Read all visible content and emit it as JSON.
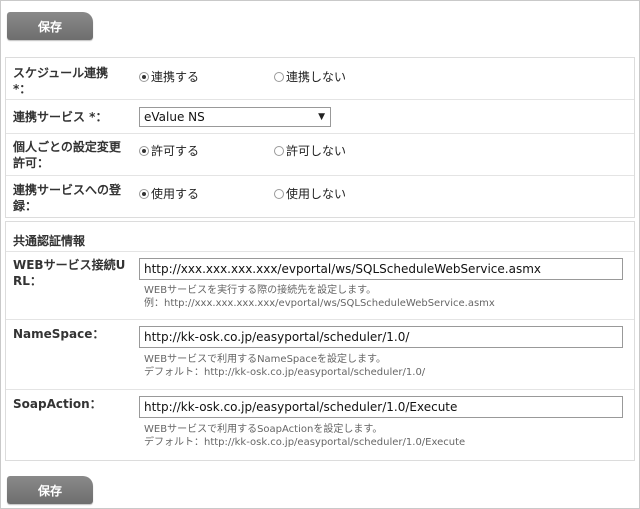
{
  "buttons": {
    "save_top": "保存",
    "save_bottom": "保存"
  },
  "settings": {
    "schedule_link": {
      "label_line1": "スケジュール連携",
      "label_line2": "*：",
      "option_on": "連携する",
      "option_off": "連携しない",
      "selected": "on"
    },
    "link_service": {
      "label": "連携サービス *：",
      "value": "eValue NS"
    },
    "personal_change": {
      "label_line1": "個人ごとの設定変更",
      "label_line2": "許可：",
      "option_on": "許可する",
      "option_off": "許可しない",
      "selected": "on"
    },
    "service_register": {
      "label_line1": "連携サービスへの登",
      "label_line2": "録：",
      "option_on": "使用する",
      "option_off": "使用しない",
      "selected": "on"
    }
  },
  "auth": {
    "title": "共通認証情報",
    "web_url": {
      "label_line1": "WEBサービス接続U",
      "label_line2": "RL：",
      "value": "http://xxx.xxx.xxx.xxx/evportal/ws/SQLScheduleWebService.asmx",
      "help1": "WEBサービスを実行する際の接続先を設定します。",
      "help2": "例：http://xxx.xxx.xxx.xxx/evportal/ws/SQLScheduleWebService.asmx"
    },
    "namespace": {
      "label": "NameSpace：",
      "value": "http://kk-osk.co.jp/easyportal/scheduler/1.0/",
      "help1": "WEBサービスで利用するNameSpaceを設定します。",
      "help2": "デフォルト：http://kk-osk.co.jp/easyportal/scheduler/1.0/"
    },
    "soapaction": {
      "label": "SoapAction：",
      "value": "http://kk-osk.co.jp/easyportal/scheduler/1.0/Execute",
      "help1": "WEBサービスで利用するSoapActionを設定します。",
      "help2": "デフォルト：http://kk-osk.co.jp/easyportal/scheduler/1.0/Execute"
    }
  }
}
